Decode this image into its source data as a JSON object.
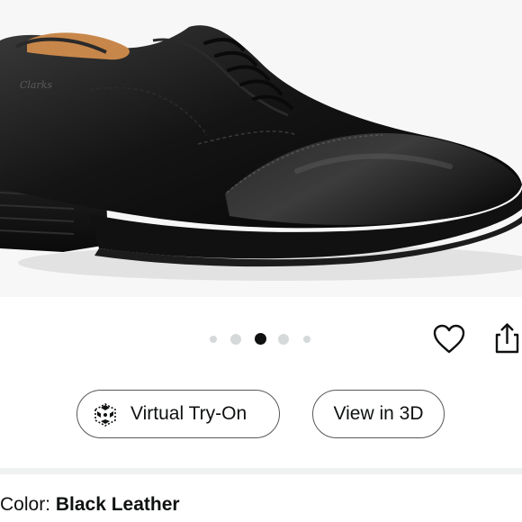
{
  "product_image": {
    "alt": "Black leather cap-toe oxford dress shoe"
  },
  "carousel": {
    "dot_count": 5,
    "active_index": 2
  },
  "actions": {
    "favorite_icon": "heart-icon",
    "share_icon": "share-icon"
  },
  "buttons": {
    "virtual_try_on": {
      "label": "Virtual Try-On",
      "icon": "ar-cube-icon"
    },
    "view_in_3d": {
      "label": "View in 3D"
    }
  },
  "color": {
    "label": "Color: ",
    "value": "Black Leather"
  },
  "colors": {
    "text": "#0f1111",
    "dot_inactive": "#d5d9d9",
    "image_bg": "#f7f7f7"
  }
}
